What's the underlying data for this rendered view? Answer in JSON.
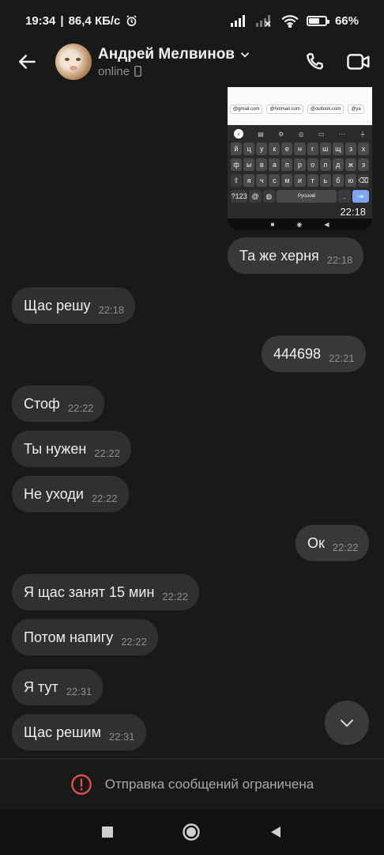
{
  "status_bar": {
    "time": "19:34",
    "speed": "86,4 КБ/с",
    "battery": "66",
    "battery_level": 0.66
  },
  "header": {
    "contact_name": "Андрей Мелвинов",
    "status": "online"
  },
  "image_message": {
    "email_chips": [
      "@gmail.com",
      "@hotmail.com",
      "@outlook.com",
      "@ya"
    ],
    "keyboard_rows": [
      [
        "й",
        "ц",
        "у",
        "к",
        "е",
        "н",
        "г",
        "ш",
        "щ",
        "з",
        "х"
      ],
      [
        "ф",
        "ы",
        "в",
        "а",
        "п",
        "р",
        "о",
        "л",
        "д",
        "ж",
        "э"
      ],
      [
        "⇧",
        "я",
        "ч",
        "с",
        "м",
        "и",
        "т",
        "ь",
        "б",
        "ю",
        "⌫"
      ]
    ],
    "keyboard_bottom": [
      "?123",
      "@",
      "◍",
      "Русский",
      ".",
      "⇥"
    ],
    "time": "22:18"
  },
  "messages": [
    {
      "text": "Та же херня",
      "time": "22:18",
      "direction": "out"
    },
    {
      "text": "Щас решу",
      "time": "22:18",
      "direction": "in"
    },
    {
      "text": "444698",
      "time": "22:21",
      "direction": "out"
    },
    {
      "text": "Стоф",
      "time": "22:22",
      "direction": "in"
    },
    {
      "text": "Ты нужен",
      "time": "22:22",
      "direction": "in"
    },
    {
      "text": "Не уходи",
      "time": "22:22",
      "direction": "in"
    },
    {
      "text": "Ок",
      "time": "22:22",
      "direction": "out"
    },
    {
      "text": "Я щас занят 15 мин",
      "time": "22:22",
      "direction": "in"
    },
    {
      "text": "Потом напигу",
      "time": "22:22",
      "direction": "in"
    },
    {
      "text": "Я тут",
      "time": "22:31",
      "direction": "in"
    },
    {
      "text": "Щас решим",
      "time": "22:31",
      "direction": "in"
    }
  ],
  "restriction": {
    "text": "Отправка сообщений ограничена",
    "icon": "alert-circle-icon",
    "color": "#e0504a"
  },
  "colors": {
    "background": "#19191a",
    "bubble": "#303032"
  }
}
